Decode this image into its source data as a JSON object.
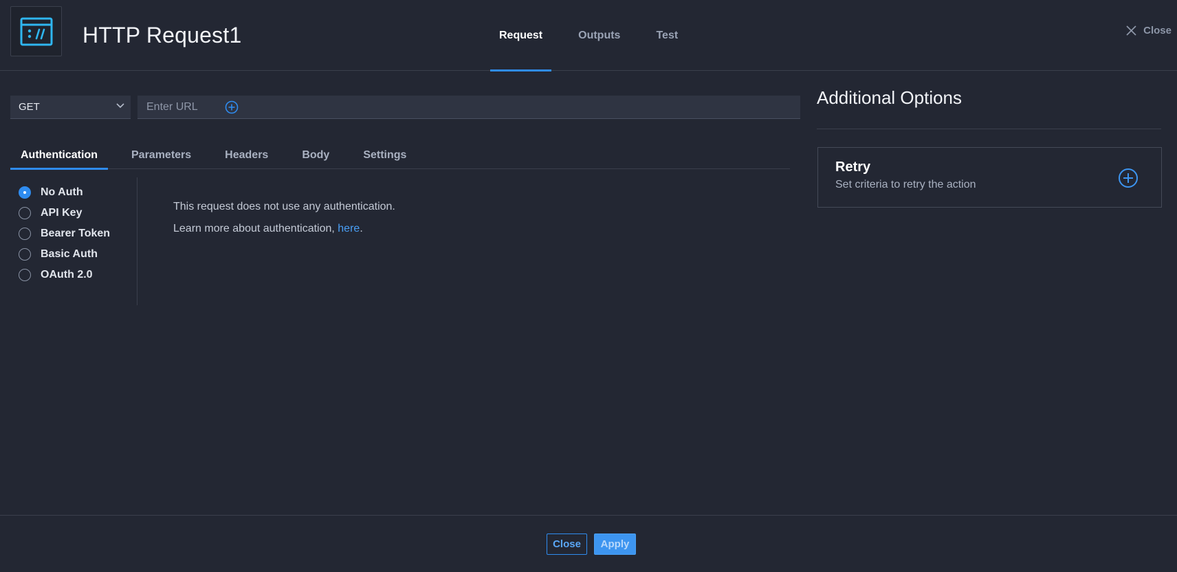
{
  "header": {
    "title": "HTTP Request1",
    "tabs": [
      {
        "label": "Request",
        "active": true
      },
      {
        "label": "Outputs",
        "active": false
      },
      {
        "label": "Test",
        "active": false
      }
    ],
    "close_label": "Close"
  },
  "request": {
    "method": "GET",
    "url_placeholder": "Enter URL",
    "url_value": "",
    "tabs": [
      {
        "label": "Authentication",
        "active": true
      },
      {
        "label": "Parameters",
        "active": false
      },
      {
        "label": "Headers",
        "active": false
      },
      {
        "label": "Body",
        "active": false
      },
      {
        "label": "Settings",
        "active": false
      }
    ],
    "auth_options": [
      {
        "label": "No Auth",
        "checked": true
      },
      {
        "label": "API Key",
        "checked": false
      },
      {
        "label": "Bearer Token",
        "checked": false
      },
      {
        "label": "Basic Auth",
        "checked": false
      },
      {
        "label": "OAuth 2.0",
        "checked": false
      }
    ],
    "auth_message": "This request does not use any authentication.",
    "learn_more_prefix": "Learn more about authentication, ",
    "learn_more_link": "here",
    "learn_more_suffix": "."
  },
  "additional_options": {
    "title": "Additional Options",
    "retry": {
      "title": "Retry",
      "description": "Set criteria to retry the action"
    }
  },
  "footer": {
    "close_label": "Close",
    "apply_label": "Apply"
  },
  "colors": {
    "background": "#232733",
    "accent": "#2f8cf0",
    "link": "#4a9ff5"
  },
  "icons": {
    "app": "http-request-icon",
    "close": "close-icon",
    "chevron": "chevron-down-icon",
    "add": "plus-circle-icon"
  }
}
